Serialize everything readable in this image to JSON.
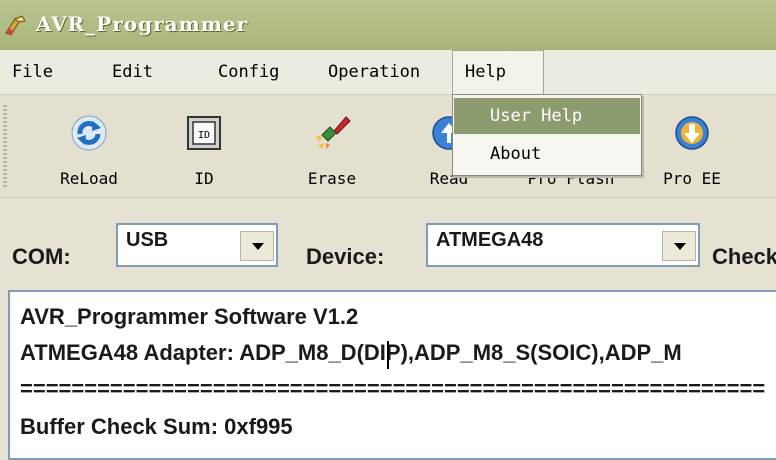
{
  "window": {
    "title": "AVR_Programmer"
  },
  "menu": {
    "items": [
      "File",
      "Edit",
      "Config",
      "Operation",
      "Help"
    ]
  },
  "help_menu": {
    "items": [
      "User Help",
      "About"
    ],
    "highlighted": "User Help"
  },
  "toolbar": {
    "buttons": [
      {
        "label": "ReLoad",
        "icon": "reload-icon"
      },
      {
        "label": "ID",
        "icon": "id-chip-icon"
      },
      {
        "label": "Erase",
        "icon": "eraser-icon"
      },
      {
        "label": "Read",
        "icon": "read-icon"
      },
      {
        "label": "Pro Flash",
        "icon": "program-flash-icon"
      },
      {
        "label": "Pro EE",
        "icon": "program-eeprom-icon"
      }
    ]
  },
  "settings": {
    "com_label": "COM:",
    "com_value": "USB",
    "device_label": "Device:",
    "device_value": "ATMEGA48",
    "check_label": "Check"
  },
  "log": {
    "lines": [
      "AVR_Programmer Software V1.2",
      "ATMEGA48 Adapter: ADP_M8_D(DIP),ADP_M8_S(SOIC),ADP_M",
      "==========================================================",
      "Buffer Check Sum: 0xf995"
    ]
  }
}
